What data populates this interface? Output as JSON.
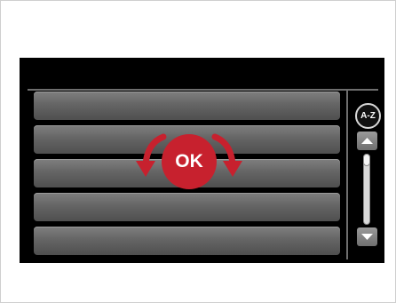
{
  "list": {
    "items": [
      {
        "label": ""
      },
      {
        "label": ""
      },
      {
        "label": ""
      },
      {
        "label": ""
      },
      {
        "label": ""
      }
    ]
  },
  "sort_button": {
    "label": "A-Z"
  },
  "ok_control": {
    "label": "OK",
    "color": "#c7212e"
  },
  "scroll": {
    "up_icon": "arrow-up-icon",
    "down_icon": "arrow-down-icon",
    "position": 0.0
  },
  "colors": {
    "screen_bg": "#000000",
    "list_item": "#656565"
  }
}
